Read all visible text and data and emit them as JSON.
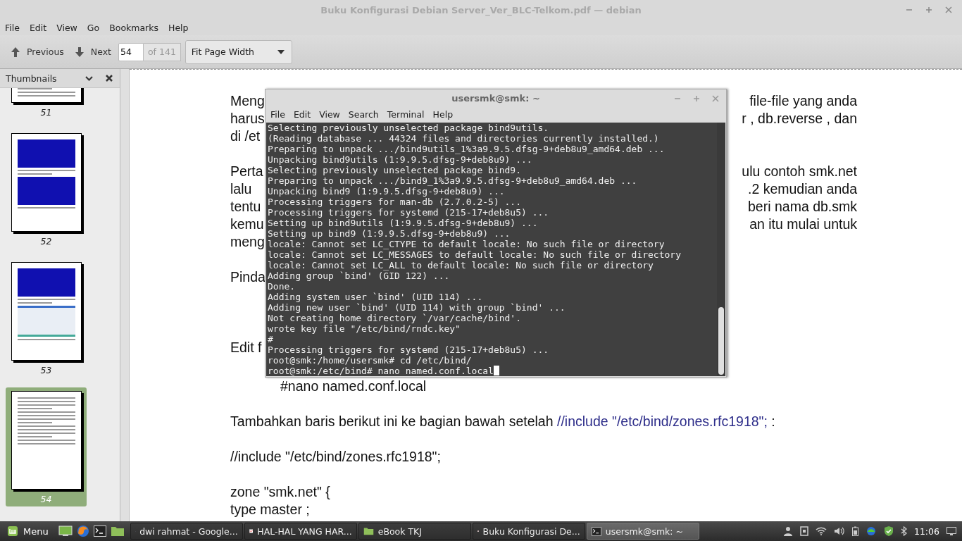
{
  "window": {
    "title": "Buku Konfigurasi Debian Server_Ver_BLC-Telkom.pdf — debian"
  },
  "menu": [
    "File",
    "Edit",
    "View",
    "Go",
    "Bookmarks",
    "Help"
  ],
  "toolbar": {
    "previous": "Previous",
    "next": "Next",
    "page": "54",
    "page_count": "of 141",
    "zoom": "Fit Page Width"
  },
  "sidebar": {
    "title": "Thumbnails",
    "pages": [
      {
        "label": "51",
        "kind": "text",
        "selected": false
      },
      {
        "label": "52",
        "kind": "screens",
        "selected": false
      },
      {
        "label": "53",
        "kind": "mixed",
        "selected": false
      },
      {
        "label": "54",
        "kind": "text",
        "selected": true
      }
    ]
  },
  "document": {
    "paragraphs": [
      {
        "kind": "split",
        "lines": [
          {
            "left": "Meng",
            "right": "file-file yang anda"
          },
          {
            "left": "harus",
            "right": "r , db.reverse , dan"
          },
          {
            "left": "di /et"
          }
        ]
      },
      {
        "kind": "split",
        "lines": [
          {
            "left": "Perta",
            "right": "ulu contoh smk.net"
          },
          {
            "left": "lalu",
            "right": ".2 kemudian anda"
          },
          {
            "left": "tentu",
            "right": "beri nama db.smk"
          },
          {
            "left": "kemu",
            "right": "an itu mulai untuk"
          },
          {
            "left": "meng"
          }
        ]
      },
      {
        "kind": "split",
        "lines": [
          {
            "left": "Pinda"
          }
        ]
      },
      {
        "kind": "split",
        "lines": [
          {
            "left": "Edit f"
          }
        ]
      },
      {
        "kind": "command",
        "lines": [
          {
            "text": "#nano named.conf.local"
          }
        ]
      },
      {
        "kind": "sentence",
        "lines": [
          {
            "text": "Tambahkan baris berikut ini ke bagian bawah setelah ",
            "link": "//include \"/etc/bind/zones.rfc1918\";",
            "tail": " :"
          }
        ]
      },
      {
        "kind": "code",
        "lines": [
          {
            "text": "//include \"/etc/bind/zones.rfc1918\";"
          }
        ]
      },
      {
        "kind": "code",
        "lines": [
          {
            "text": "zone \"smk.net\" {"
          },
          {
            "text": "type master ;"
          }
        ]
      }
    ]
  },
  "terminal": {
    "title": "usersmk@smk: ~",
    "menu": [
      "File",
      "Edit",
      "View",
      "Search",
      "Terminal",
      "Help"
    ],
    "lines": [
      "Selecting previously unselected package bind9utils.",
      "(Reading database ... 44324 files and directories currently installed.)",
      "Preparing to unpack .../bind9utils_1%3a9.9.5.dfsg-9+deb8u9_amd64.deb ...",
      "Unpacking bind9utils (1:9.9.5.dfsg-9+deb8u9) ...",
      "Selecting previously unselected package bind9.",
      "Preparing to unpack .../bind9_1%3a9.9.5.dfsg-9+deb8u9_amd64.deb ...",
      "Unpacking bind9 (1:9.9.5.dfsg-9+deb8u9) ...",
      "Processing triggers for man-db (2.7.0.2-5) ...",
      "Processing triggers for systemd (215-17+deb8u5) ...",
      "Setting up bind9utils (1:9.9.5.dfsg-9+deb8u9) ...",
      "Setting up bind9 (1:9.9.5.dfsg-9+deb8u9) ...",
      "locale: Cannot set LC_CTYPE to default locale: No such file or directory",
      "locale: Cannot set LC_MESSAGES to default locale: No such file or directory",
      "locale: Cannot set LC_ALL to default locale: No such file or directory",
      "Adding group `bind' (GID 122) ...",
      "Done.",
      "Adding system user `bind' (UID 114) ...",
      "Adding new user `bind' (UID 114) with group `bind' ...",
      "Not creating home directory `/var/cache/bind'.",
      "wrote key file \"/etc/bind/rndc.key\"",
      "#",
      "Processing triggers for systemd (215-17+deb8u5) ...",
      "root@smk:/home/usersmk# cd /etc/bind/",
      "root@smk:/etc/bind# nano named.conf.local"
    ]
  },
  "taskbar": {
    "menu": "Menu",
    "tasks": [
      {
        "label": "dwi rahmat - Google...",
        "kind": "browser",
        "selected": false
      },
      {
        "label": "HAL-HAL YANG HAR...",
        "kind": "pdf",
        "selected": false
      },
      {
        "label": "eBook TKJ",
        "kind": "folder",
        "selected": false
      },
      {
        "label": "Buku Konfigurasi De...",
        "kind": "pdf",
        "selected": false
      },
      {
        "label": "usersmk@smk: ~",
        "kind": "terminal",
        "selected": true
      }
    ],
    "clock": "11:06"
  }
}
